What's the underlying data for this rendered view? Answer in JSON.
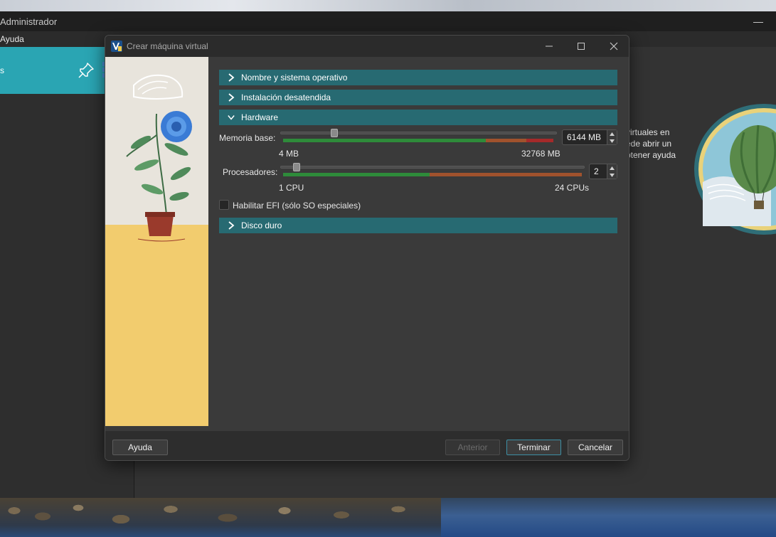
{
  "app": {
    "title": "Administrador",
    "menu": {
      "help": "Ayuda"
    },
    "sidebar": {
      "tools_label": "s"
    },
    "welcome_lines": [
      "virtuales en",
      "ede abrir un",
      "btener ayuda"
    ]
  },
  "dialog": {
    "title": "Crear máquina virtual",
    "sections": {
      "name_os": "Nombre y sistema operativo",
      "unattended": "Instalación desatendida",
      "hardware": "Hardware",
      "disk": "Disco duro"
    },
    "hardware": {
      "memory": {
        "label": "Memoria base:",
        "value": "6144 MB",
        "value_mb": 6144,
        "min": "4 MB",
        "max": "32768 MB"
      },
      "processors": {
        "label": "Procesadores:",
        "value": "2",
        "min": "1 CPU",
        "max": "24 CPUs"
      },
      "efi": {
        "label": "Habilitar EFI (sólo SO especiales)",
        "checked": false
      }
    },
    "buttons": {
      "help": "Ayuda",
      "back": "Anterior",
      "finish": "Terminar",
      "cancel": "Cancelar"
    }
  },
  "colors": {
    "accent": "#2aa5b3",
    "section_header": "#276a72",
    "scale_green": "#2e8b3a",
    "scale_orange": "#a0522d",
    "scale_red": "#a52a2a"
  }
}
